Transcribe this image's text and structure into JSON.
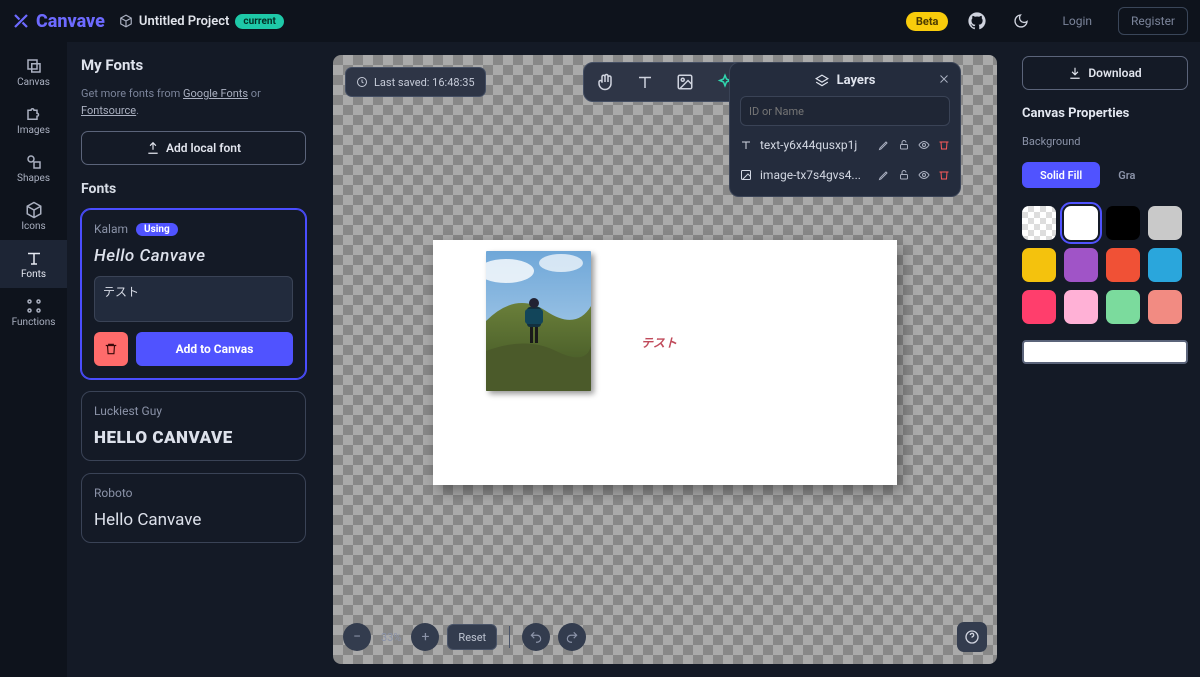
{
  "header": {
    "brand": "Canvave",
    "project_title": "Untitled Project",
    "chip_current": "current",
    "beta": "Beta",
    "login": "Login",
    "register": "Register"
  },
  "rail": {
    "items": [
      {
        "key": "canvas",
        "label": "Canvas"
      },
      {
        "key": "images",
        "label": "Images"
      },
      {
        "key": "shapes",
        "label": "Shapes"
      },
      {
        "key": "icons",
        "label": "Icons"
      },
      {
        "key": "fonts",
        "label": "Fonts"
      },
      {
        "key": "functions",
        "label": "Functions"
      }
    ],
    "active": "fonts"
  },
  "sidepanel": {
    "title": "My Fonts",
    "hint_pre": "Get more fonts from ",
    "hint_link1": "Google Fonts",
    "hint_mid": " or ",
    "hint_link2": "Fontsource",
    "hint_post": ".",
    "add_local": "Add local font",
    "fonts_heading": "Fonts",
    "fonts": [
      {
        "name": "Kalam",
        "sample": "Hello Canvave",
        "using": true,
        "input": "テスト"
      },
      {
        "name": "Luckiest Guy",
        "sample": "HELLO CANVAVE",
        "using": false
      },
      {
        "name": "Roboto",
        "sample": "Hello Canvave",
        "using": false
      }
    ],
    "using_chip": "Using",
    "add_to_canvas": "Add to Canvas"
  },
  "canvas": {
    "lastsaved_label": "Last saved: 16:48:35",
    "toolbar_icons": [
      "pan",
      "text",
      "image",
      "ai"
    ],
    "layers": {
      "title": "Layers",
      "search_placeholder": "ID or Name",
      "items": [
        {
          "type": "text",
          "name": "text-y6x44qusxp1j"
        },
        {
          "type": "image",
          "name": "image-tx7s4gvs4..."
        }
      ]
    },
    "artboard_text": "テスト",
    "zoom_percent": "33%",
    "reset": "Reset"
  },
  "right": {
    "download": "Download",
    "props_title": "Canvas Properties",
    "background_label": "Background",
    "tabs": {
      "solid": "Solid Fill",
      "gradient": "Gra"
    },
    "swatches": [
      "checker",
      "#ffffff",
      "#000000",
      "#c9c9c9",
      "#f4c20d",
      "#a054c7",
      "#f05136",
      "#2aa6dc",
      "#ff3e6c",
      "#ffb1d6",
      "#7bdb9d",
      "#f28b82"
    ],
    "selected_swatch_index": 1,
    "current_color": "#ffffff"
  }
}
